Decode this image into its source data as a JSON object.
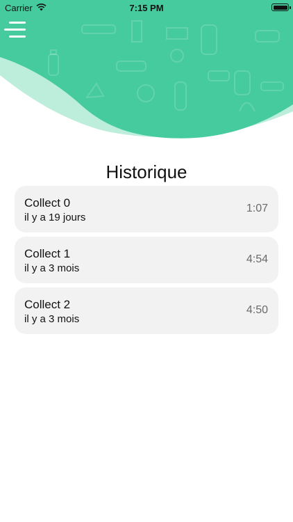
{
  "status_bar": {
    "carrier": "Carrier",
    "time": "7:15 PM",
    "wifi_icon": "wifi-icon",
    "battery_icon": "battery-icon",
    "battery_level": 1.0
  },
  "header": {
    "menu_icon": "hamburger-menu-icon",
    "accent_color": "#45cb9e",
    "light_accent_color": "#bdeedc"
  },
  "page": {
    "title": "Historique"
  },
  "collects": [
    {
      "name": "Collect 0",
      "date": "il y a 19 jours",
      "duration": "1:07"
    },
    {
      "name": "Collect 1",
      "date": "il y a 3 mois",
      "duration": "4:54"
    },
    {
      "name": "Collect 2",
      "date": "il y a 3 mois",
      "duration": "4:50"
    }
  ]
}
